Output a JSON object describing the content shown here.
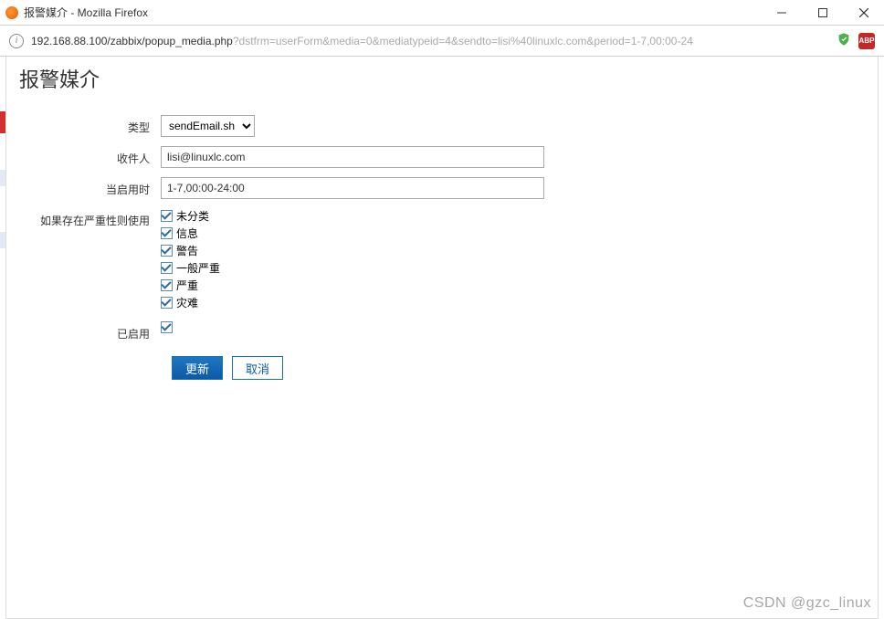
{
  "window": {
    "title": "报警媒介 - Mozilla Firefox"
  },
  "addressbar": {
    "url_main": "192.168.88.100/zabbix/popup_media.php",
    "url_query": "?dstfrm=userForm&media=0&mediatypeid=4&sendto=lisi%40linuxlc.com&period=1-7,00:00-24",
    "abp_label": "ABP"
  },
  "page": {
    "title": "报警媒介"
  },
  "form": {
    "type_label": "类型",
    "type_value": "sendEmail.sh",
    "recipient_label": "收件人",
    "recipient_value": "lisi@linuxlc.com",
    "when_label": "当启用时",
    "when_value": "1-7,00:00-24:00",
    "severity_label": "如果存在严重性则使用",
    "severities": [
      {
        "label": "未分类",
        "checked": true
      },
      {
        "label": "信息",
        "checked": true
      },
      {
        "label": "警告",
        "checked": true
      },
      {
        "label": "一般严重",
        "checked": true
      },
      {
        "label": "严重",
        "checked": true
      },
      {
        "label": "灾难",
        "checked": true
      }
    ],
    "enabled_label": "已启用",
    "enabled_checked": true
  },
  "buttons": {
    "update": "更新",
    "cancel": "取消"
  },
  "watermark": "CSDN @gzc_linux"
}
